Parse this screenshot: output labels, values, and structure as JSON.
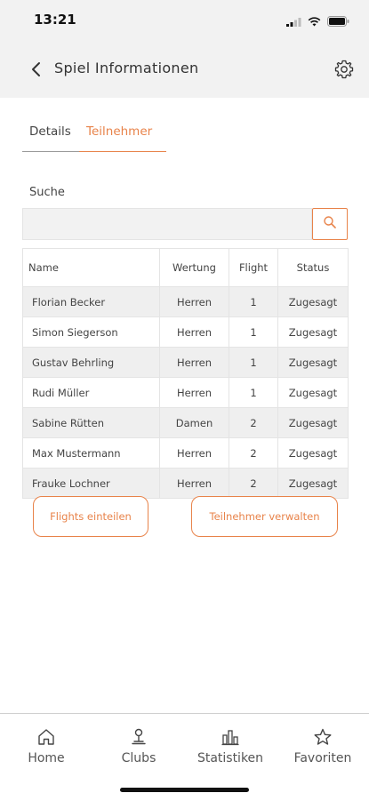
{
  "status": {
    "time": "13:21"
  },
  "nav": {
    "title": "Spiel Informationen",
    "back_icon": "chevron-left-icon",
    "settings_icon": "gear-icon"
  },
  "tabs": [
    {
      "label": "Details",
      "active": false
    },
    {
      "label": "Teilnehmer",
      "active": true
    }
  ],
  "search": {
    "label": "Suche",
    "value": "",
    "placeholder": ""
  },
  "table": {
    "headers": {
      "name": "Name",
      "wertung": "Wertung",
      "flight": "Flight",
      "status": "Status"
    },
    "rows": [
      {
        "name": "Florian Becker",
        "wertung": "Herren",
        "flight": "1",
        "status": "Zugesagt"
      },
      {
        "name": "Simon Siegerson",
        "wertung": "Herren",
        "flight": "1",
        "status": "Zugesagt"
      },
      {
        "name": "Gustav Behrling",
        "wertung": "Herren",
        "flight": "1",
        "status": "Zugesagt"
      },
      {
        "name": "Rudi Müller",
        "wertung": "Herren",
        "flight": "1",
        "status": "Zugesagt"
      },
      {
        "name": "Sabine Rütten",
        "wertung": "Damen",
        "flight": "2",
        "status": "Zugesagt"
      },
      {
        "name": "Max Mustermann",
        "wertung": "Herren",
        "flight": "2",
        "status": "Zugesagt"
      },
      {
        "name": "Frauke Lochner",
        "wertung": "Herren",
        "flight": "2",
        "status": "Zugesagt"
      }
    ]
  },
  "actions": {
    "flights_label": "Flights einteilen",
    "manage_label": "Teilnehmer verwalten"
  },
  "bottom_nav": [
    {
      "label": "Home",
      "icon": "home-icon"
    },
    {
      "label": "Clubs",
      "icon": "golf-flag-icon"
    },
    {
      "label": "Statistiken",
      "icon": "bar-chart-icon"
    },
    {
      "label": "Favoriten",
      "icon": "star-icon"
    }
  ],
  "colors": {
    "accent": "#e8834a",
    "header_bg": "#f2f2f2",
    "row_alt": "#efefef",
    "text": "#333333"
  }
}
